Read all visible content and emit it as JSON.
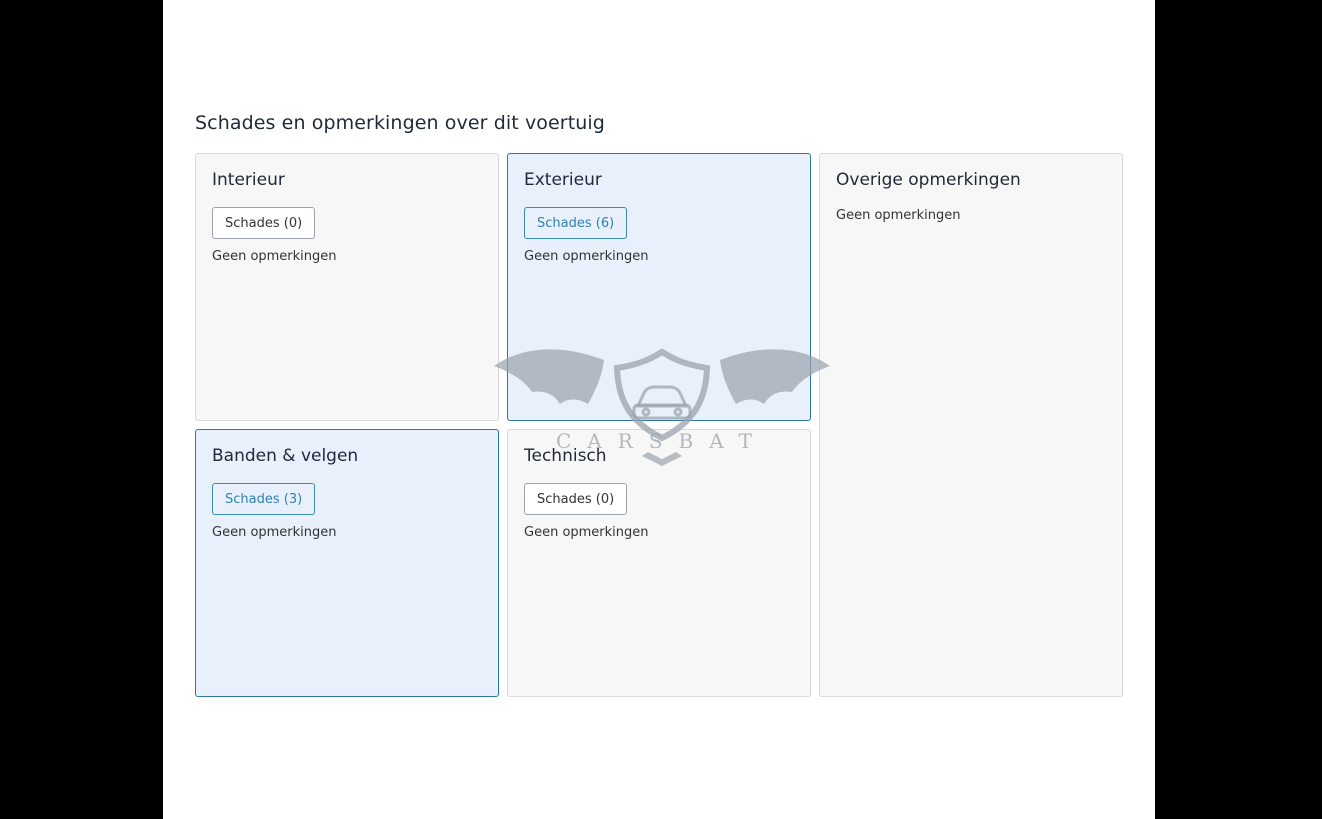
{
  "section": {
    "title": "Schades en opmerkingen over dit voertuig"
  },
  "cards": {
    "interieur": {
      "title": "Interieur",
      "damage_button": "Schades (0)",
      "note": "Geen opmerkingen"
    },
    "exterieur": {
      "title": "Exterieur",
      "damage_button": "Schades (6)",
      "note": "Geen opmerkingen"
    },
    "overige": {
      "title": "Overige opmerkingen",
      "note": "Geen opmerkingen"
    },
    "banden": {
      "title": "Banden & velgen",
      "damage_button": "Schades (3)",
      "note": "Geen opmerkingen"
    },
    "technisch": {
      "title": "Technisch",
      "damage_button": "Schades (0)",
      "note": "Geen opmerkingen"
    }
  },
  "watermark": {
    "text": "CARSBAT",
    "color": "#9aa3ad"
  },
  "colors": {
    "active_background": "#e8f0fb",
    "active_border": "#2b7a99",
    "card_background": "#f7f7f7"
  }
}
